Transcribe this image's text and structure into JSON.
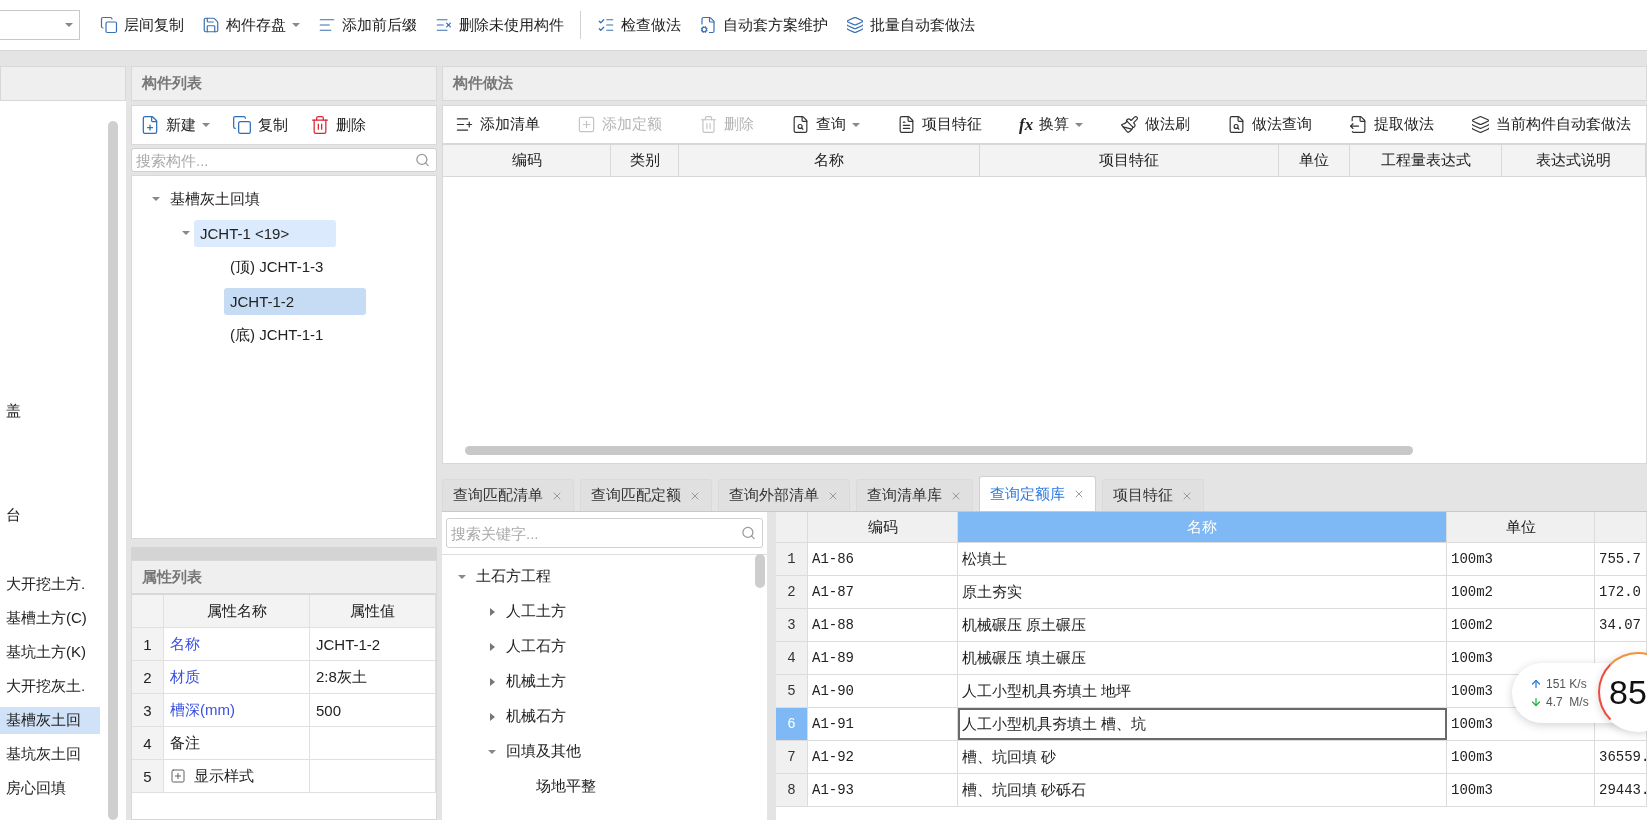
{
  "toolbar": {
    "groups": [
      [
        {
          "label": "层间复制",
          "dropdown": false
        },
        {
          "label": "构件存盘",
          "dropdown": true
        },
        {
          "label": "添加前后缀",
          "dropdown": false
        },
        {
          "label": "删除未使用构件",
          "dropdown": false
        }
      ],
      [
        {
          "label": "检查做法",
          "dropdown": false
        },
        {
          "label": "自动套方案维护",
          "dropdown": false
        },
        {
          "label": "批量自动套做法",
          "dropdown": false
        }
      ]
    ]
  },
  "left_panel": {
    "items": [
      {
        "label": "盖",
        "kind": "fragment",
        "selected": false
      },
      {
        "label": "台",
        "kind": "fragment",
        "selected": false
      },
      {
        "label": "大开挖土方.",
        "kind": "item",
        "selected": false
      },
      {
        "label": "基槽土方(C)",
        "kind": "item",
        "selected": false
      },
      {
        "label": "基坑土方(K)",
        "kind": "item",
        "selected": false
      },
      {
        "label": "大开挖灰土.",
        "kind": "item",
        "selected": false
      },
      {
        "label": "基槽灰土回",
        "kind": "item",
        "selected": true
      },
      {
        "label": "基坑灰土回",
        "kind": "item",
        "selected": false
      },
      {
        "label": "房心回填",
        "kind": "item",
        "selected": false
      }
    ]
  },
  "component_list": {
    "title": "构件列表",
    "actions": [
      {
        "label": "新建",
        "dropdown": true
      },
      {
        "label": "复制",
        "dropdown": false
      },
      {
        "label": "删除",
        "dropdown": false
      }
    ],
    "search": {
      "placeholder": "搜索构件..."
    },
    "tree": [
      {
        "label": "基槽灰土回填",
        "selected": false,
        "highlighted": false,
        "expanded": true,
        "children": [
          {
            "label": "JCHT-1 <19>",
            "selected": false,
            "highlighted": true,
            "expanded": true,
            "children": [
              {
                "label": "(顶) JCHT-1-3",
                "selected": false,
                "highlighted": false
              },
              {
                "label": "JCHT-1-2",
                "selected": true,
                "highlighted": false
              },
              {
                "label": "(底) JCHT-1-1",
                "selected": false,
                "highlighted": false
              }
            ]
          }
        ]
      }
    ]
  },
  "properties": {
    "title": "属性列表",
    "columns": [
      "属性名称",
      "属性值"
    ],
    "rows": [
      {
        "index": "1",
        "name": "名称",
        "value": "JCHT-1-2",
        "kind": "public"
      },
      {
        "index": "2",
        "name": "材质",
        "value": "2:8灰土",
        "kind": "public"
      },
      {
        "index": "3",
        "name": "槽深(mm)",
        "value": "500",
        "kind": "public"
      },
      {
        "index": "4",
        "name": "备注",
        "kind": "private"
      },
      {
        "index": "5",
        "name": "显示样式",
        "kind": "group"
      }
    ]
  },
  "method_panel": {
    "title": "构件做法",
    "actions": [
      {
        "label": "添加清单",
        "disabled": false,
        "dropdown": false
      },
      {
        "label": "添加定额",
        "disabled": true,
        "dropdown": false
      },
      {
        "label": "删除",
        "disabled": true,
        "dropdown": false
      },
      {
        "label": "查询",
        "disabled": false,
        "dropdown": true
      },
      {
        "label": "项目特征",
        "disabled": false,
        "dropdown": false
      },
      {
        "label": "换算",
        "glyph": "fx",
        "disabled": false,
        "dropdown": true
      },
      {
        "label": "做法刷",
        "disabled": false,
        "dropdown": false
      },
      {
        "label": "做法查询",
        "disabled": false,
        "dropdown": false
      },
      {
        "label": "提取做法",
        "disabled": false,
        "dropdown": false
      },
      {
        "label": "当前构件自动套做法",
        "disabled": false,
        "dropdown": false
      }
    ],
    "columns": [
      "编码",
      "类别",
      "名称",
      "项目特征",
      "单位",
      "工程量表达式",
      "表达式说明"
    ]
  },
  "query_tabs": [
    {
      "label": "查询匹配清单",
      "selected": false
    },
    {
      "label": "查询匹配定额",
      "selected": false
    },
    {
      "label": "查询外部清单",
      "selected": false
    },
    {
      "label": "查询清单库",
      "selected": false
    },
    {
      "label": "查询定额库",
      "selected": true
    },
    {
      "label": "项目特征",
      "selected": false
    }
  ],
  "library": {
    "search": {
      "placeholder": "搜索关键字..."
    },
    "tree": [
      {
        "label": "土石方工程",
        "expanded": true,
        "children": [
          {
            "label": "人工土方",
            "expanded": false
          },
          {
            "label": "人工石方",
            "expanded": false
          },
          {
            "label": "机械土方",
            "expanded": false
          },
          {
            "label": "机械石方",
            "expanded": false
          },
          {
            "label": "回填及其他",
            "expanded": true,
            "children": [
              {
                "label": "场地平整"
              }
            ]
          }
        ]
      }
    ]
  },
  "quota_table": {
    "columns": [
      {
        "label": "编码",
        "selected": false
      },
      {
        "label": "名称",
        "selected": true
      },
      {
        "label": "单位",
        "selected": false
      }
    ],
    "rows": [
      {
        "index": "1",
        "code": "A1-86",
        "name": "松填土",
        "unit": "100m3",
        "column_4": "755.7",
        "selected": false
      },
      {
        "index": "2",
        "code": "A1-87",
        "name": "原土夯实",
        "unit": "100m2",
        "column_4": "172.0",
        "selected": false
      },
      {
        "index": "3",
        "code": "A1-88",
        "name": "机械碾压 原土碾压",
        "unit": "100m2",
        "column_4": "34.07",
        "selected": false
      },
      {
        "index": "4",
        "code": "A1-89",
        "name": "机械碾压 填土碾压",
        "unit": "100m3",
        "selected": false
      },
      {
        "index": "5",
        "code": "A1-90",
        "name": "人工小型机具夯填土 地坪",
        "unit": "100m3",
        "selected": false
      },
      {
        "index": "6",
        "code": "A1-91",
        "name": "人工小型机具夯填土 槽、坑",
        "unit": "100m3",
        "selected": true
      },
      {
        "index": "7",
        "code": "A1-92",
        "name": "槽、坑回填 砂",
        "unit": "100m3",
        "column_4": "36559.",
        "selected": false
      },
      {
        "index": "8",
        "code": "A1-93",
        "name": "槽、坑回填 砂砾石",
        "unit": "100m3",
        "column_4": "29443.",
        "selected": false
      }
    ]
  },
  "net_speed": {
    "upload": "151 K/s",
    "download": "4.7  M/s",
    "score": "85"
  }
}
